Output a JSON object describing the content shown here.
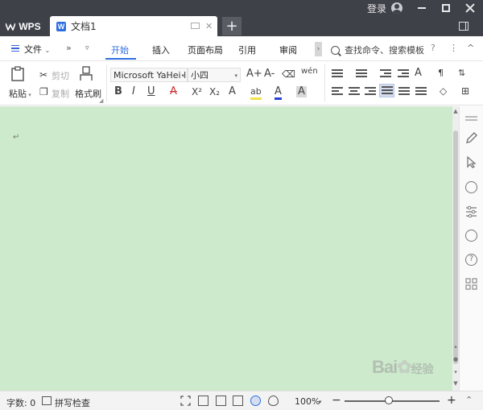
{
  "titlebar": {
    "login_label": "登录",
    "app_tab_label": "WPS",
    "doc_tab_label": "文档1",
    "doc_badge": "W",
    "new_tab_symbol": "+",
    "close_symbol": "✕"
  },
  "menubar": {
    "file_label": "文件",
    "more_symbol": "»",
    "tabs": [
      "开始",
      "插入",
      "页面布局",
      "引用",
      "审阅"
    ],
    "active_tab": "开始",
    "search_placeholder": "查找命令、搜索模板",
    "help_symbol": "?",
    "more_dots": "⋮",
    "collapse_symbol": "^"
  },
  "ribbon": {
    "paste_label": "粘贴",
    "cut_label": "剪切",
    "copy_label": "复制",
    "format_painter_label": "格式刷",
    "font_name": "Microsoft YaHei l",
    "font_size": "小四",
    "font_inc": "A+",
    "font_dec": "A-",
    "phonetic_label": "wén",
    "bold": "B",
    "italic": "I",
    "underline": "U",
    "strike": "A",
    "superscript": "X²",
    "subscript": "X₂",
    "effect": "A",
    "highlight": "ab",
    "color": "A",
    "char_shade": "A"
  },
  "document": {
    "paragraph_mark": "↵"
  },
  "statusbar": {
    "word_count_label": "字数: 0",
    "spell_check_label": "拼写检查",
    "zoom_level": "100%",
    "zoom_minus": "−",
    "zoom_plus": "+",
    "zoom_fraction": 0.47
  },
  "watermark": {
    "text": "Bai",
    "suffix": "经验"
  },
  "colors": {
    "titlebar": "#3f4149",
    "accent": "#2f6ee0",
    "doc_bg": "#cdeacc"
  }
}
